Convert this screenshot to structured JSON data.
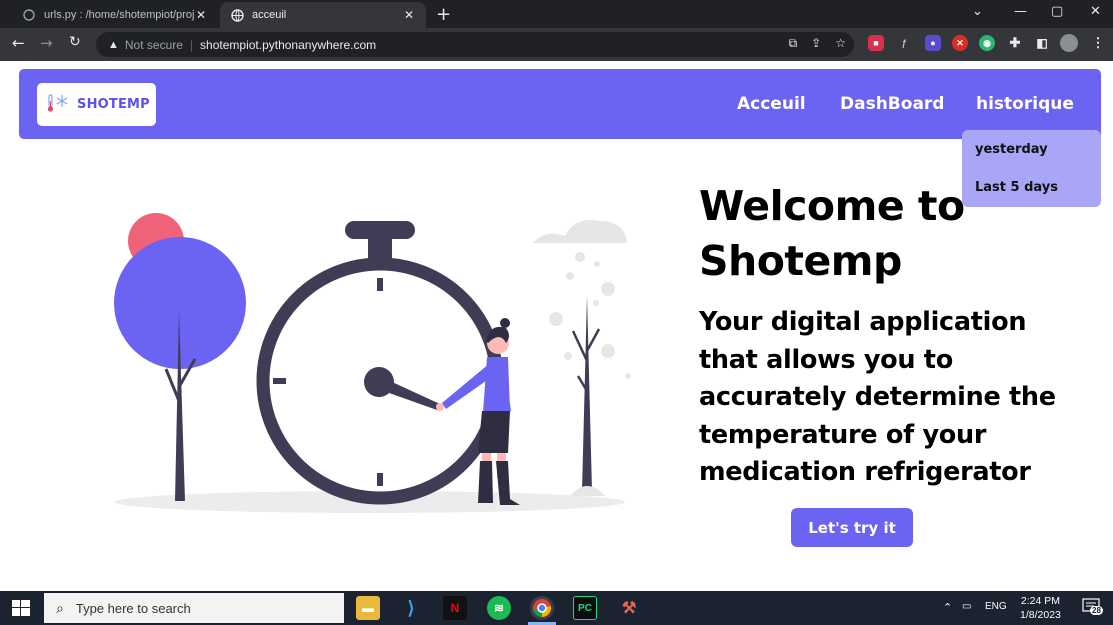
{
  "browser": {
    "tabs": [
      {
        "title": "urls.py : /home/shotempiot/proje",
        "active": false
      },
      {
        "title": "acceuil",
        "active": true
      }
    ],
    "omnibox": {
      "security_label": "Not secure",
      "url": "shotempiot.pythonanywhere.com"
    }
  },
  "site": {
    "logo_text": "SHOTEMP",
    "nav": {
      "home": "Acceuil",
      "dashboard": "DashBoard",
      "history": "historique"
    },
    "dropdown": {
      "items": [
        "yesterday",
        "Last 5 days"
      ]
    },
    "hero": {
      "title_line1": "Welcome to",
      "title_line2": "Shotemp",
      "subtitle_lines": [
        "Your digital application",
        "that allows you to",
        "accurately determine the",
        "temperature of your",
        "medication refrigerator"
      ],
      "cta": "Let's try it"
    },
    "colors": {
      "brand": "#6b63f2",
      "dropdown": "#a9a5f7",
      "illustration_dark": "#3f3d56",
      "illustration_pink": "#f0627a"
    }
  },
  "taskbar": {
    "search_placeholder": "Type here to search",
    "language": "ENG",
    "time": "2:24 PM",
    "date": "1/8/2023",
    "notifications": "28"
  }
}
